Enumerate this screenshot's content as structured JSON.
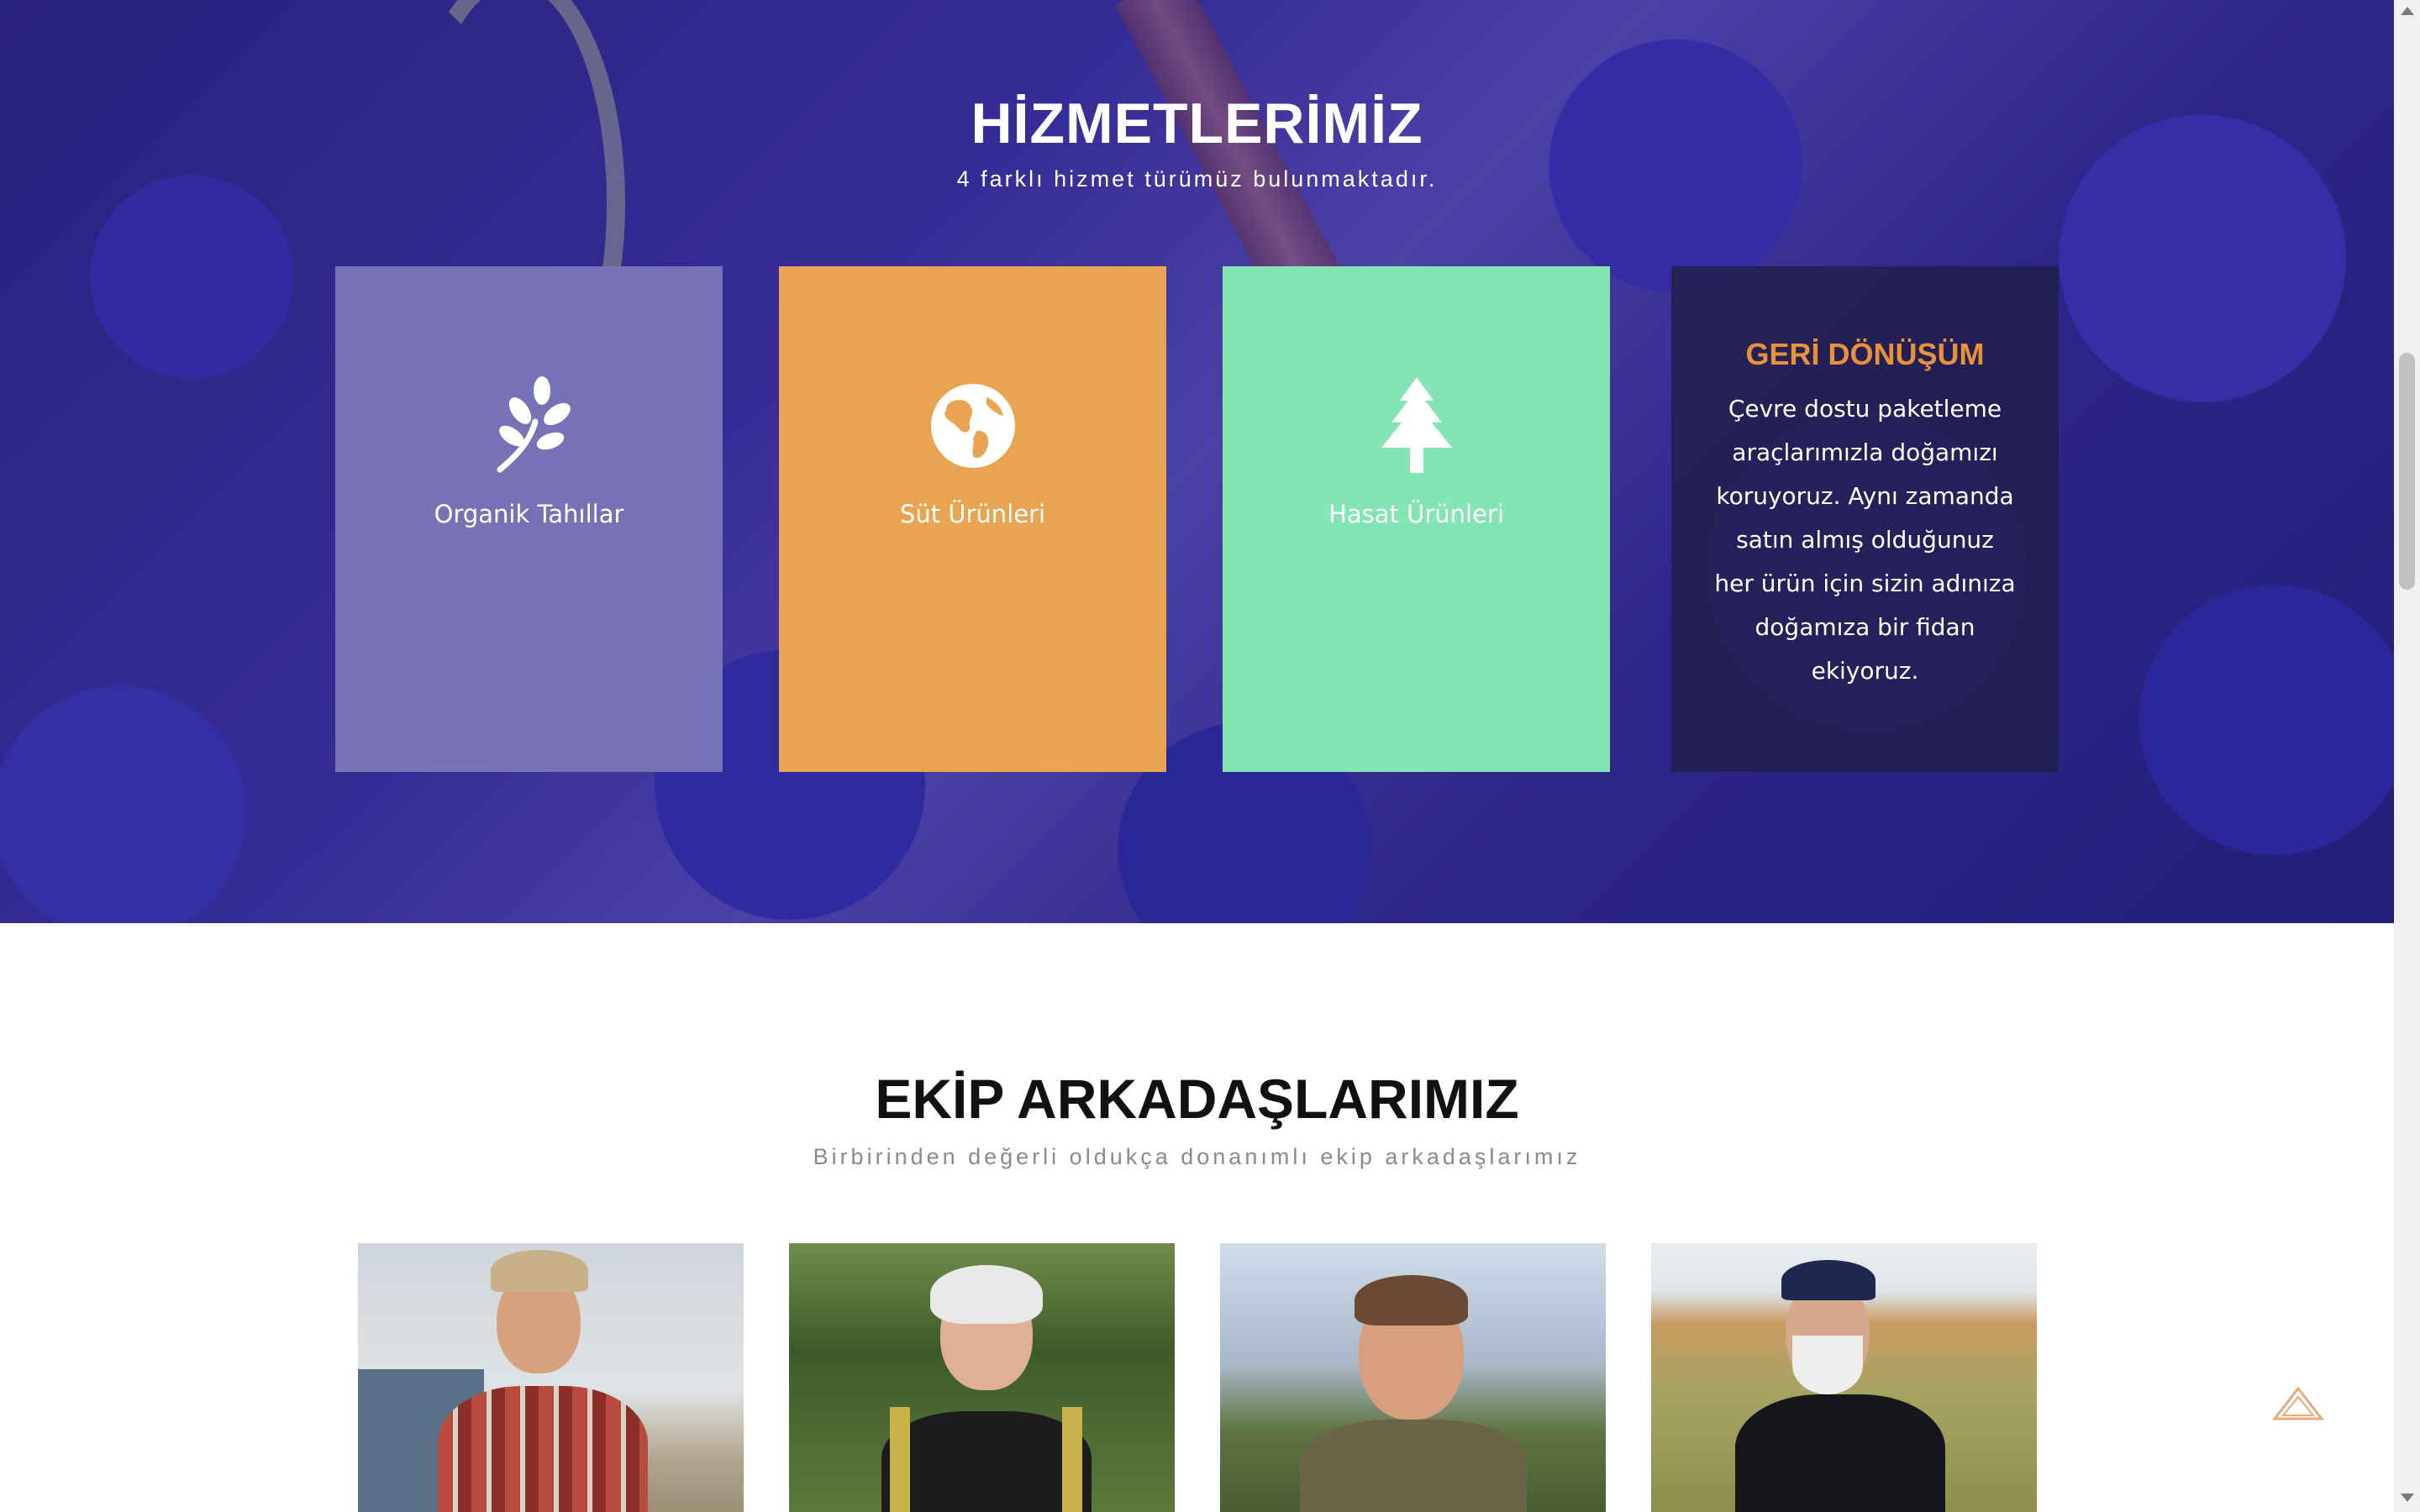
{
  "services": {
    "title": "HİZMETLERİMİZ",
    "subtitle": "4 farklı hizmet türümüz bulunmaktadır.",
    "cards": [
      {
        "label": "Organik Tahıllar",
        "icon": "leaf-icon",
        "color": "#7672b5"
      },
      {
        "label": "Süt Ürünleri",
        "icon": "globe-icon",
        "color": "#e9a452"
      },
      {
        "label": "Hasat Ürünleri",
        "icon": "tree-icon",
        "color": "#83e5b3"
      }
    ],
    "featured": {
      "title": "GERİ DÖNÜŞÜM",
      "text": "Çevre dostu paketleme araçlarımızla doğamızı koruyoruz. Aynı zamanda satın almış olduğunuz her ürün için sizin adınıza doğamıza bir fidan ekiyoruz.",
      "title_color": "#e8913a"
    }
  },
  "team": {
    "title": "EKİP ARKADAŞLARIMIZ",
    "subtitle": "Birbirinden değerli oldukça donanımlı ekip arkadaşlarımız"
  },
  "colors": {
    "accent": "#e8913a"
  }
}
